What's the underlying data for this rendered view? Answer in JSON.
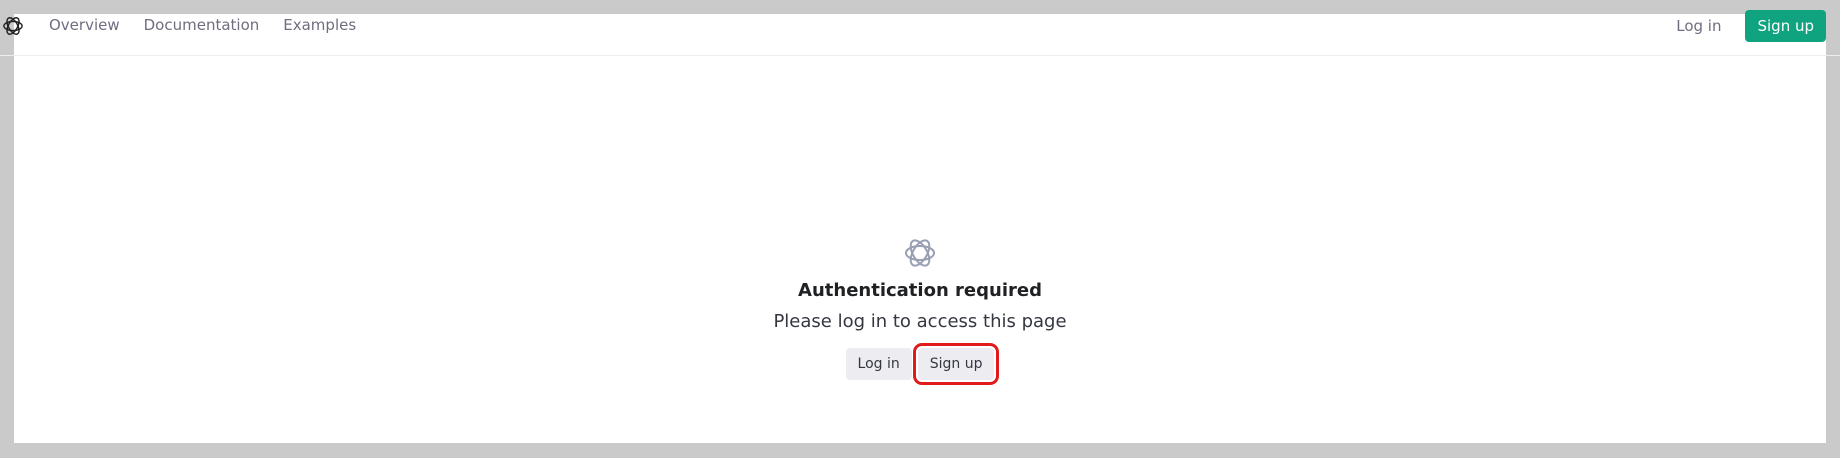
{
  "nav": {
    "logo_icon": "openai-logo-icon",
    "links": [
      "Overview",
      "Documentation",
      "Examples"
    ],
    "login_label": "Log in",
    "signup_label": "Sign up"
  },
  "auth": {
    "logo_icon": "openai-logo-icon",
    "title": "Authentication required",
    "subtitle": "Please log in to access this page",
    "login_label": "Log in",
    "signup_label": "Sign up"
  },
  "colors": {
    "accent": "#10a37f",
    "highlight": "#e01b1b",
    "background": "#cacaca"
  }
}
